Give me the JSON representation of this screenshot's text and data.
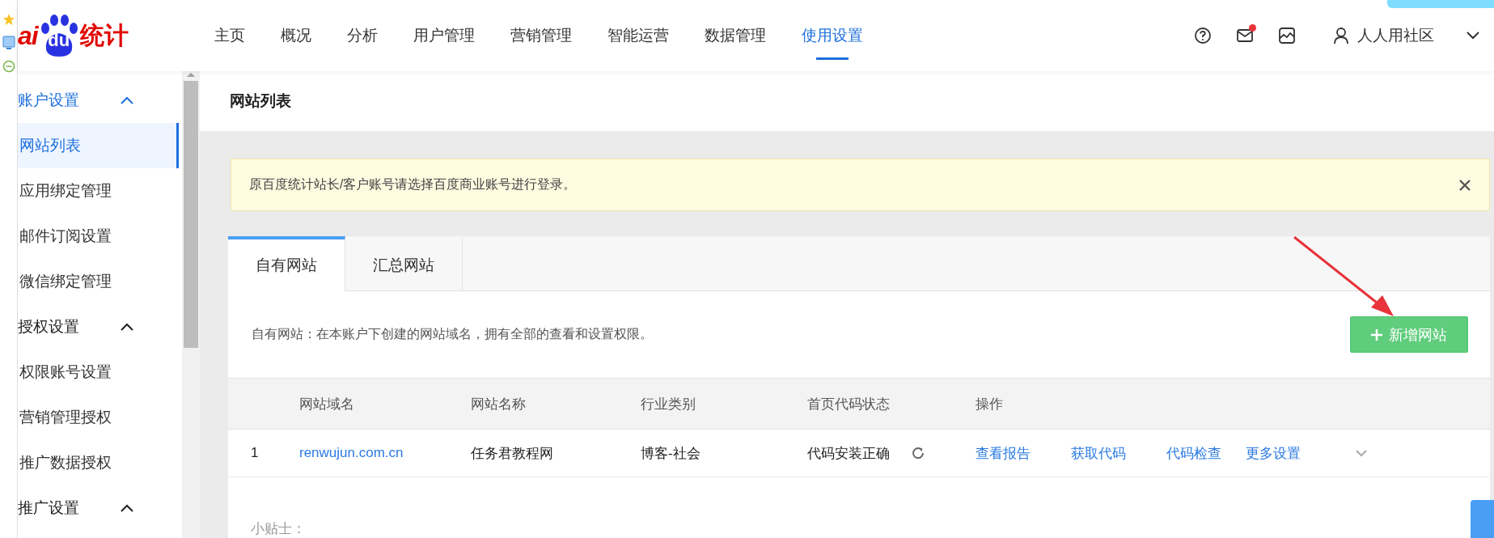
{
  "logo": {
    "prefix": "ai",
    "paw_text": "du",
    "suffix": "统计"
  },
  "nav": [
    {
      "label": "主页",
      "selected": false
    },
    {
      "label": "概况",
      "selected": false
    },
    {
      "label": "分析",
      "selected": false
    },
    {
      "label": "用户管理",
      "selected": false
    },
    {
      "label": "营销管理",
      "selected": false
    },
    {
      "label": "智能运营",
      "selected": false
    },
    {
      "label": "数据管理",
      "selected": false
    },
    {
      "label": "使用设置",
      "selected": true
    }
  ],
  "header_icons": {
    "mail_has_notification": true
  },
  "user": {
    "name": "人人用社区"
  },
  "sidebar": [
    {
      "label": "账户设置",
      "expanded": true,
      "items": [
        {
          "label": "网站列表",
          "selected": true
        },
        {
          "label": "应用绑定管理",
          "selected": false
        },
        {
          "label": "邮件订阅设置",
          "selected": false
        },
        {
          "label": "微信绑定管理",
          "selected": false
        }
      ]
    },
    {
      "label": "授权设置",
      "expanded": true,
      "items": [
        {
          "label": "权限账号设置",
          "selected": false
        },
        {
          "label": "营销管理授权",
          "selected": false
        },
        {
          "label": "推广数据授权",
          "selected": false
        }
      ]
    },
    {
      "label": "推广设置",
      "expanded": true
    }
  ],
  "page_title": "网站列表",
  "notice": {
    "text": "原百度统计站长/客户账号请选择百度商业账号进行登录。"
  },
  "tabs": [
    {
      "label": "自有网站",
      "selected": true
    },
    {
      "label": "汇总网站",
      "selected": false
    }
  ],
  "description": "自有网站：在本账户下创建的网站域名，拥有全部的查看和设置权限。",
  "add_button": {
    "label": "新增网站"
  },
  "table": {
    "columns": [
      "网站域名",
      "网站名称",
      "行业类别",
      "首页代码状态",
      "操作"
    ],
    "rows": [
      {
        "index": "1",
        "domain": "renwujun.com.cn",
        "name": "任务君教程网",
        "industry": "博客-社会",
        "status": "代码安装正确",
        "actions": [
          "查看报告",
          "获取代码",
          "代码检查",
          "更多设置"
        ]
      }
    ]
  },
  "tips": {
    "title": "小贴士："
  }
}
